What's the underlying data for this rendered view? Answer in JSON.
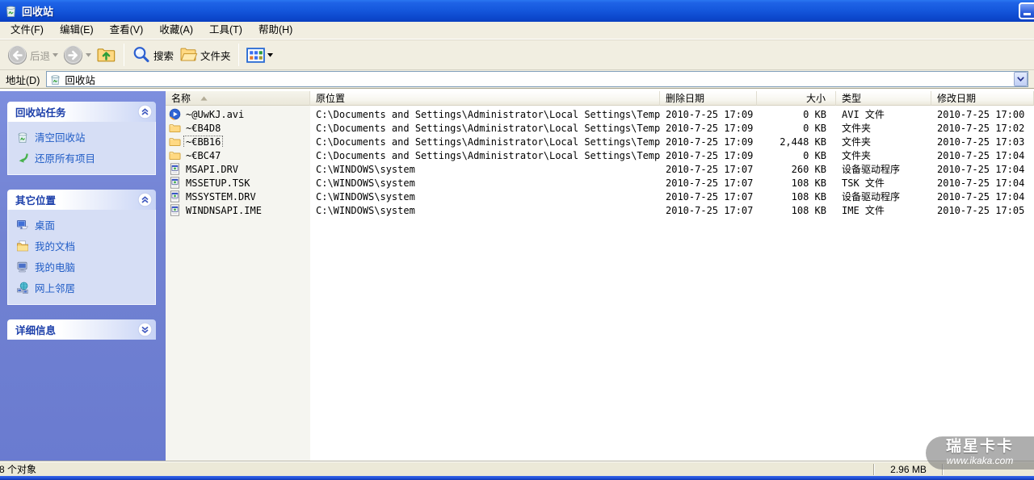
{
  "colors": {
    "titlebar_blue": "#1558dd",
    "sidebar_blue": "#7182d2",
    "panel_body_blue": "#d6def5",
    "link_blue": "#215dc6",
    "toolbar_beige": "#f1eee1",
    "statusbar_beige": "#ece9d8"
  },
  "window": {
    "title": "回收站",
    "app_icon": "recycle-bin-icon"
  },
  "menu": {
    "items": [
      "文件(F)",
      "编辑(E)",
      "查看(V)",
      "收藏(A)",
      "工具(T)",
      "帮助(H)"
    ]
  },
  "toolbar": {
    "back_label": "后退",
    "search_label": "搜索",
    "folders_label": "文件夹"
  },
  "address": {
    "label": "地址(D)",
    "value": "回收站",
    "value_icon": "recycle-bin-icon"
  },
  "sidebar": {
    "panels": [
      {
        "id": "recycle-bin-tasks",
        "title": "回收站任务",
        "collapsed": false,
        "items": [
          {
            "icon": "empty-recycle-bin-icon",
            "label": "清空回收站"
          },
          {
            "icon": "restore-items-icon",
            "label": "还原所有项目"
          }
        ]
      },
      {
        "id": "other-places",
        "title": "其它位置",
        "collapsed": false,
        "items": [
          {
            "icon": "desktop-icon",
            "label": "桌面"
          },
          {
            "icon": "my-documents-icon",
            "label": "我的文档"
          },
          {
            "icon": "my-computer-icon",
            "label": "我的电脑"
          },
          {
            "icon": "network-places-icon",
            "label": "网上邻居"
          }
        ]
      },
      {
        "id": "details",
        "title": "详细信息",
        "collapsed": true,
        "items": []
      }
    ]
  },
  "list": {
    "columns": [
      {
        "label": "名称",
        "sort": "asc"
      },
      {
        "label": "原位置"
      },
      {
        "label": "删除日期"
      },
      {
        "label": "大小"
      },
      {
        "label": "类型"
      },
      {
        "label": "修改日期"
      }
    ],
    "rows": [
      {
        "icon": "media-file-icon",
        "name": "~@UwKJ.avi",
        "location": "C:\\Documents and Settings\\Administrator\\Local Settings\\Temp",
        "deleted": "2010-7-25 17:09",
        "size": "0 KB",
        "type": "AVI 文件",
        "modified": "2010-7-25 17:00",
        "focused": false
      },
      {
        "icon": "folder-icon",
        "name": "~€B4D8",
        "location": "C:\\Documents and Settings\\Administrator\\Local Settings\\Temp",
        "deleted": "2010-7-25 17:09",
        "size": "0 KB",
        "type": "文件夹",
        "modified": "2010-7-25 17:02",
        "focused": false
      },
      {
        "icon": "folder-icon",
        "name": "~€BB16",
        "location": "C:\\Documents and Settings\\Administrator\\Local Settings\\Temp",
        "deleted": "2010-7-25 17:09",
        "size": "2,448 KB",
        "type": "文件夹",
        "modified": "2010-7-25 17:03",
        "focused": true
      },
      {
        "icon": "folder-icon",
        "name": "~€BC47",
        "location": "C:\\Documents and Settings\\Administrator\\Local Settings\\Temp",
        "deleted": "2010-7-25 17:09",
        "size": "0 KB",
        "type": "文件夹",
        "modified": "2010-7-25 17:04",
        "focused": false
      },
      {
        "icon": "system-file-icon",
        "name": "MSAPI.DRV",
        "location": "C:\\WINDOWS\\system",
        "deleted": "2010-7-25 17:07",
        "size": "260 KB",
        "type": "设备驱动程序",
        "modified": "2010-7-25 17:04",
        "focused": false
      },
      {
        "icon": "system-file-icon",
        "name": "MSSETUP.TSK",
        "location": "C:\\WINDOWS\\system",
        "deleted": "2010-7-25 17:07",
        "size": "108 KB",
        "type": "TSK 文件",
        "modified": "2010-7-25 17:04",
        "focused": false
      },
      {
        "icon": "system-file-icon",
        "name": "MSSYSTEM.DRV",
        "location": "C:\\WINDOWS\\system",
        "deleted": "2010-7-25 17:07",
        "size": "108 KB",
        "type": "设备驱动程序",
        "modified": "2010-7-25 17:04",
        "focused": false
      },
      {
        "icon": "system-file-icon",
        "name": "WINDNSAPI.IME",
        "location": "C:\\WINDOWS\\system",
        "deleted": "2010-7-25 17:07",
        "size": "108 KB",
        "type": "IME 文件",
        "modified": "2010-7-25 17:05",
        "focused": false
      }
    ]
  },
  "statusbar": {
    "objects": "8 个对象",
    "total_size": "2.96 MB"
  },
  "watermark": {
    "title": "瑞星卡卡",
    "url": "www.ikaka.com"
  }
}
